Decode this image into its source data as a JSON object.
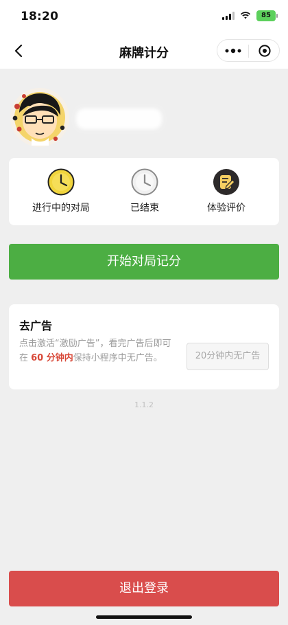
{
  "status_bar": {
    "time": "18:20",
    "battery": "85"
  },
  "nav": {
    "title": "麻牌计分"
  },
  "menu": [
    {
      "label": "进行中的对局",
      "icon": "yellow-clock-icon"
    },
    {
      "label": "已结束",
      "icon": "gray-clock-icon"
    },
    {
      "label": "体验评价",
      "icon": "edit-note-icon"
    }
  ],
  "start_button_label": "开始对局记分",
  "ad": {
    "title": "去广告",
    "desc_before": "点击激活“激励广告”，看完广告后即可在 ",
    "highlight": "60 分钟内",
    "desc_after": "保持小程序中无广告。",
    "button_label": "20分钟内无广告"
  },
  "version": "1.1.2",
  "logout_label": "退出登录",
  "colors": {
    "primary_green": "#4cae43",
    "logout_red": "#d94d4c",
    "highlight_red": "#d84838",
    "background": "#efefef"
  }
}
